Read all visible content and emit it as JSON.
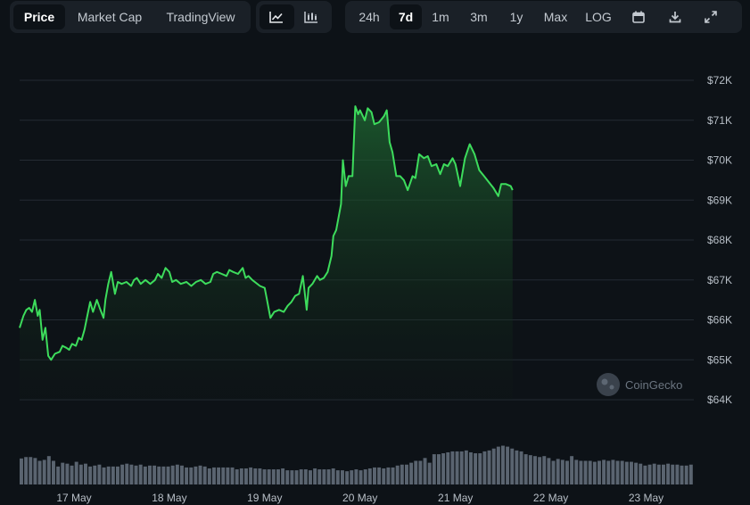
{
  "toolbar": {
    "metric_tabs": [
      {
        "label": "Price",
        "active": true
      },
      {
        "label": "Market Cap",
        "active": false
      },
      {
        "label": "TradingView",
        "active": false
      }
    ],
    "chart_style_buttons": [
      {
        "icon": "line-chart-icon",
        "active": true
      },
      {
        "icon": "candlestick-chart-icon",
        "active": false
      }
    ],
    "ranges": [
      {
        "label": "24h",
        "active": false
      },
      {
        "label": "7d",
        "active": true
      },
      {
        "label": "1m",
        "active": false
      },
      {
        "label": "3m",
        "active": false
      },
      {
        "label": "1y",
        "active": false
      },
      {
        "label": "Max",
        "active": false
      },
      {
        "label": "LOG",
        "active": false
      }
    ],
    "icons": [
      "calendar-icon",
      "download-icon",
      "expand-icon"
    ]
  },
  "watermark": "CoinGecko",
  "colors": {
    "line": "#3ddc5c",
    "fill_top": "#1f6b33",
    "grid": "#242b33",
    "volume": "#5a6470",
    "background": "#0d1217"
  },
  "chart_data": {
    "type": "area",
    "x_labels": [
      "17 May",
      "18 May",
      "19 May",
      "20 May",
      "21 May",
      "22 May",
      "23 May"
    ],
    "y_ticks": [
      "$72K",
      "$71K",
      "$70K",
      "$69K",
      "$68K",
      "$67K",
      "$66K",
      "$65K",
      "$64K"
    ],
    "ylim": [
      64000,
      72000
    ],
    "xlim": [
      16.43,
      23.5
    ],
    "grid": true,
    "series": [
      {
        "values": [
          [
            16.43,
            65800
          ],
          [
            16.47,
            66100
          ],
          [
            16.5,
            66250
          ],
          [
            16.53,
            66300
          ],
          [
            16.56,
            66200
          ],
          [
            16.59,
            66500
          ],
          [
            16.62,
            66100
          ],
          [
            16.64,
            66250
          ],
          [
            16.67,
            65500
          ],
          [
            16.7,
            65800
          ],
          [
            16.73,
            65100
          ],
          [
            16.76,
            65000
          ],
          [
            16.8,
            65150
          ],
          [
            16.85,
            65200
          ],
          [
            16.88,
            65350
          ],
          [
            16.92,
            65300
          ],
          [
            16.95,
            65250
          ],
          [
            16.98,
            65400
          ],
          [
            17.02,
            65350
          ],
          [
            17.05,
            65550
          ],
          [
            17.08,
            65500
          ],
          [
            17.11,
            65750
          ],
          [
            17.14,
            66100
          ],
          [
            17.17,
            66450
          ],
          [
            17.2,
            66200
          ],
          [
            17.24,
            66500
          ],
          [
            17.27,
            66300
          ],
          [
            17.31,
            66050
          ],
          [
            17.33,
            66500
          ],
          [
            17.36,
            66900
          ],
          [
            17.39,
            67200
          ],
          [
            17.43,
            66650
          ],
          [
            17.46,
            66950
          ],
          [
            17.5,
            66900
          ],
          [
            17.55,
            66950
          ],
          [
            17.6,
            66850
          ],
          [
            17.63,
            67000
          ],
          [
            17.66,
            67050
          ],
          [
            17.7,
            66900
          ],
          [
            17.75,
            67000
          ],
          [
            17.8,
            66900
          ],
          [
            17.85,
            67000
          ],
          [
            17.88,
            67150
          ],
          [
            17.92,
            67050
          ],
          [
            17.96,
            67300
          ],
          [
            18.0,
            67200
          ],
          [
            18.03,
            66950
          ],
          [
            18.07,
            67000
          ],
          [
            18.12,
            66900
          ],
          [
            18.18,
            66950
          ],
          [
            18.23,
            66850
          ],
          [
            18.28,
            66950
          ],
          [
            18.33,
            67000
          ],
          [
            18.38,
            66900
          ],
          [
            18.43,
            66950
          ],
          [
            18.46,
            67150
          ],
          [
            18.5,
            67200
          ],
          [
            18.55,
            67150
          ],
          [
            18.6,
            67100
          ],
          [
            18.63,
            67250
          ],
          [
            18.67,
            67200
          ],
          [
            18.72,
            67150
          ],
          [
            18.77,
            67300
          ],
          [
            18.8,
            67050
          ],
          [
            18.83,
            67100
          ],
          [
            18.87,
            67000
          ],
          [
            18.95,
            66850
          ],
          [
            19.0,
            66800
          ],
          [
            19.02,
            66550
          ],
          [
            19.06,
            66050
          ],
          [
            19.1,
            66200
          ],
          [
            19.15,
            66250
          ],
          [
            19.2,
            66200
          ],
          [
            19.24,
            66350
          ],
          [
            19.28,
            66450
          ],
          [
            19.32,
            66600
          ],
          [
            19.36,
            66650
          ],
          [
            19.4,
            67100
          ],
          [
            19.44,
            66250
          ],
          [
            19.46,
            66800
          ],
          [
            19.5,
            66900
          ],
          [
            19.55,
            67100
          ],
          [
            19.58,
            67000
          ],
          [
            19.62,
            67050
          ],
          [
            19.66,
            67200
          ],
          [
            19.7,
            67600
          ],
          [
            19.72,
            68100
          ],
          [
            19.75,
            68250
          ],
          [
            19.8,
            68900
          ],
          [
            19.82,
            70000
          ],
          [
            19.85,
            69350
          ],
          [
            19.88,
            69600
          ],
          [
            19.92,
            69600
          ],
          [
            19.95,
            71350
          ],
          [
            19.98,
            71150
          ],
          [
            20.0,
            71250
          ],
          [
            20.05,
            71000
          ],
          [
            20.08,
            71300
          ],
          [
            20.12,
            71200
          ],
          [
            20.15,
            70900
          ],
          [
            20.2,
            70950
          ],
          [
            20.25,
            71100
          ],
          [
            20.28,
            71250
          ],
          [
            20.31,
            70450
          ],
          [
            20.34,
            70200
          ],
          [
            20.38,
            69600
          ],
          [
            20.42,
            69600
          ],
          [
            20.46,
            69500
          ],
          [
            20.5,
            69250
          ],
          [
            20.55,
            69600
          ],
          [
            20.58,
            69550
          ],
          [
            20.62,
            70150
          ],
          [
            20.67,
            70050
          ],
          [
            20.71,
            70100
          ],
          [
            20.75,
            69850
          ],
          [
            20.8,
            69900
          ],
          [
            20.84,
            69650
          ],
          [
            20.88,
            69900
          ],
          [
            20.92,
            69850
          ],
          [
            20.97,
            70050
          ],
          [
            21.0,
            69900
          ],
          [
            21.05,
            69350
          ],
          [
            21.1,
            70050
          ],
          [
            21.15,
            70400
          ],
          [
            21.2,
            70150
          ],
          [
            21.25,
            69750
          ],
          [
            21.3,
            69600
          ],
          [
            21.35,
            69450
          ],
          [
            21.4,
            69300
          ],
          [
            21.45,
            69100
          ],
          [
            21.48,
            69400
          ],
          [
            21.53,
            69400
          ],
          [
            21.58,
            69350
          ],
          [
            21.6,
            69250
          ]
        ]
      }
    ],
    "volume_relative": [
      0.55,
      0.58,
      0.58,
      0.56,
      0.5,
      0.52,
      0.6,
      0.5,
      0.38,
      0.46,
      0.44,
      0.4,
      0.48,
      0.42,
      0.44,
      0.38,
      0.4,
      0.42,
      0.36,
      0.38,
      0.38,
      0.38,
      0.42,
      0.44,
      0.42,
      0.4,
      0.42,
      0.38,
      0.4,
      0.4,
      0.38,
      0.38,
      0.38,
      0.4,
      0.42,
      0.4,
      0.36,
      0.36,
      0.38,
      0.4,
      0.38,
      0.34,
      0.36,
      0.36,
      0.36,
      0.36,
      0.36,
      0.32,
      0.34,
      0.34,
      0.36,
      0.34,
      0.34,
      0.32,
      0.32,
      0.32,
      0.32,
      0.34,
      0.3,
      0.3,
      0.3,
      0.32,
      0.32,
      0.3,
      0.34,
      0.32,
      0.32,
      0.32,
      0.34,
      0.3,
      0.3,
      0.28,
      0.3,
      0.32,
      0.3,
      0.32,
      0.34,
      0.36,
      0.36,
      0.34,
      0.36,
      0.36,
      0.4,
      0.42,
      0.42,
      0.46,
      0.5,
      0.5,
      0.56,
      0.46,
      0.64,
      0.64,
      0.66,
      0.68,
      0.7,
      0.7,
      0.7,
      0.72,
      0.68,
      0.66,
      0.66,
      0.7,
      0.72,
      0.76,
      0.8,
      0.82,
      0.8,
      0.76,
      0.72,
      0.7,
      0.64,
      0.62,
      0.6,
      0.58,
      0.6,
      0.56,
      0.5,
      0.54,
      0.52,
      0.5,
      0.6,
      0.52,
      0.5,
      0.5,
      0.5,
      0.48,
      0.5,
      0.52,
      0.5,
      0.52,
      0.5,
      0.5,
      0.48,
      0.48,
      0.46,
      0.44,
      0.4,
      0.42,
      0.44,
      0.42,
      0.42,
      0.44,
      0.42,
      0.42,
      0.4,
      0.4,
      0.42
    ]
  }
}
